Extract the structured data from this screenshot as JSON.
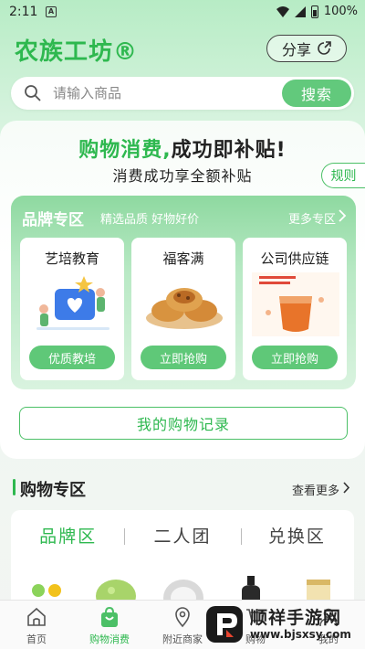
{
  "status_bar": {
    "time": "2:11",
    "notification_glyph": "A",
    "battery": "100%"
  },
  "header": {
    "brand_title": "农族工坊®",
    "share_label": "分享"
  },
  "search": {
    "placeholder": "请输入商品",
    "button_label": "搜索"
  },
  "promo": {
    "headline_green": "购物消费,",
    "headline_rest": "成功即补贴!",
    "subtitle": "消费成功享全额补贴",
    "rules_label": "规则"
  },
  "brand_zone": {
    "title": "品牌专区",
    "tagline": "精选品质 好物好价",
    "more_label": "更多专区",
    "items": [
      {
        "name": "艺培教育",
        "button": "优质教培"
      },
      {
        "name": "福客满",
        "button": "立即抢购"
      },
      {
        "name": "公司供应链",
        "button": "立即抢购"
      }
    ]
  },
  "records_button": "我的购物记录",
  "shopping": {
    "title": "购物专区",
    "more_label": "查看更多",
    "tabs": [
      {
        "label": "品牌区",
        "active": true
      },
      {
        "label": "二人团",
        "active": false
      },
      {
        "label": "兑换区",
        "active": false
      }
    ]
  },
  "bottom_nav": [
    {
      "label": "首页",
      "icon": "home-icon",
      "active": false
    },
    {
      "label": "购物消费",
      "icon": "shopping-bag-icon",
      "active": true
    },
    {
      "label": "附近商家",
      "icon": "location-pin-icon",
      "active": false
    },
    {
      "label": "购物",
      "icon": "cart-icon",
      "active": false
    },
    {
      "label": "我的",
      "icon": "user-icon",
      "active": false
    }
  ],
  "watermark": {
    "name": "顺祥手游网",
    "url": "www.bjsxsy.com"
  },
  "colors": {
    "accent": "#2eb84f",
    "button_green": "#5fc878",
    "background": "#e9f5ec"
  }
}
